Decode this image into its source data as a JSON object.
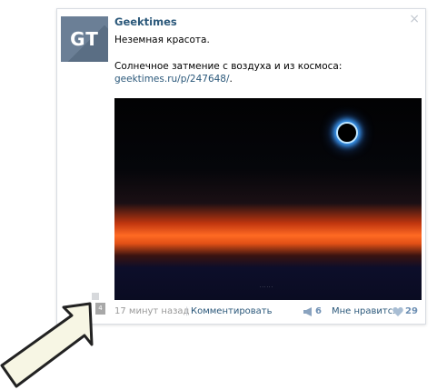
{
  "post": {
    "author": "Geektimes",
    "avatar_text": "GT",
    "text_line1": "Неземная красота.",
    "text_line2": "Солнечное затмение с воздуха и из космоса:",
    "link_text": "geektimes.ru/p/247648/",
    "link_suffix": ".",
    "close_icon": "×"
  },
  "footer": {
    "time": "17 минут назад",
    "divider": "|",
    "comment_label": "Комментировать",
    "share_count": "6",
    "like_label": "Мне нравится",
    "like_count": "29"
  },
  "badge": {
    "count": "4"
  },
  "colors": {
    "link": "#2b587a",
    "muted": "#999999",
    "count": "#6d8fb3",
    "arrow_fill": "#f7f6e4"
  },
  "icons": [
    "close-icon",
    "megaphone-icon",
    "heart-icon",
    "arrow-pointer-icon"
  ]
}
